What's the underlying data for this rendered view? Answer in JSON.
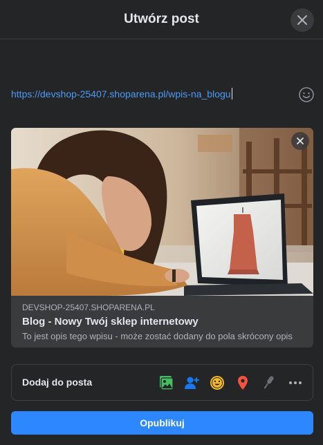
{
  "dialog": {
    "title": "Utwórz post"
  },
  "composer": {
    "text": "https://devshop-25407.shoparena.pl/wpis-na_blogu"
  },
  "link_preview": {
    "domain": "DEVSHOP-25407.SHOPARENA.PL",
    "title": "Blog - Nowy Twój sklep internetowy",
    "description": "To jest opis tego wpisu - może zostać dodany do pola skrócony opis"
  },
  "add_to_post": {
    "label": "Dodaj do posta",
    "icons": [
      "photo-video-icon",
      "tag-people-icon",
      "feeling-icon",
      "check-in-icon",
      "microphone-icon",
      "more-icon"
    ]
  },
  "publish": {
    "label": "Opublikuj"
  },
  "colors": {
    "background": "#242526",
    "accent": "#2d88ff",
    "link": "#4c9bf5",
    "photo_green": "#45bd62",
    "tag_blue": "#1877f2",
    "feeling_yellow": "#f7b928",
    "checkin_red": "#f5533d"
  }
}
